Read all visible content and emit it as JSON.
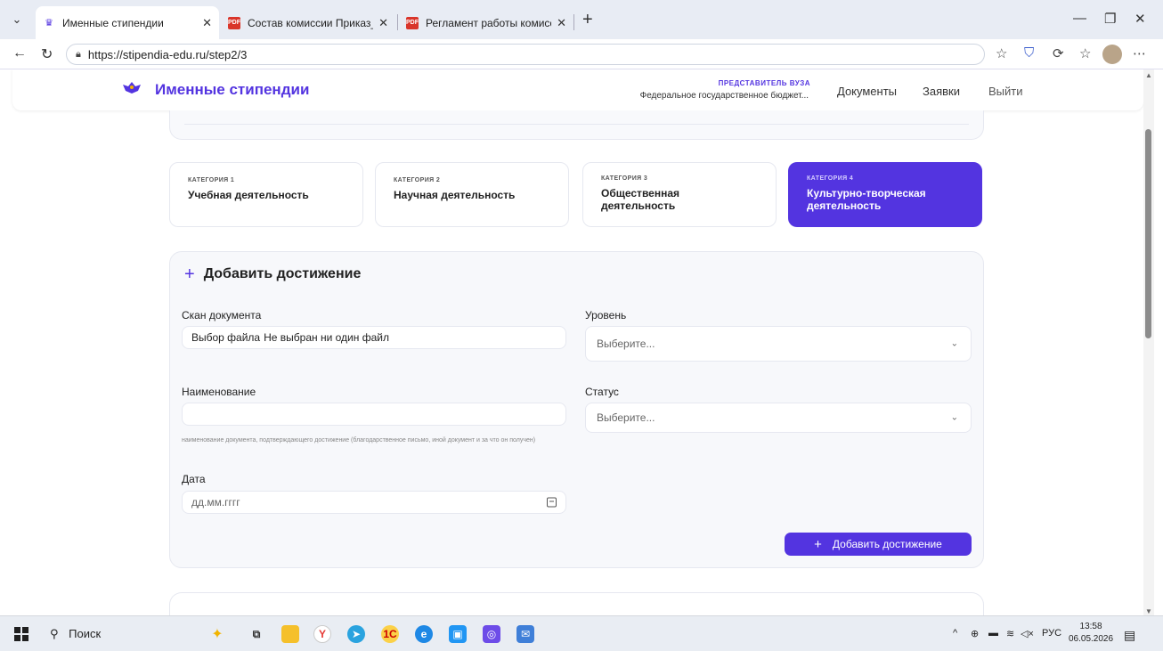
{
  "browser": {
    "tabs": [
      {
        "title": "Именные стипендии",
        "active": true,
        "icon": "scholarship-logo-icon"
      },
      {
        "title": "Состав комиссии Приказ_№296_",
        "active": false,
        "icon": "pdf-icon"
      },
      {
        "title": "Регламент работы комиссии Ми",
        "active": false,
        "icon": "pdf-icon"
      }
    ],
    "url": "https://stipendia-edu.ru/step2/3"
  },
  "site": {
    "name": "Именные стипендии",
    "role_label": "ПРЕДСТАВИТЕЛЬ ВУЗА",
    "organization": "Федеральное государственное бюджет...",
    "nav": [
      {
        "label": "Документы"
      },
      {
        "label": "Заявки"
      },
      {
        "label": "Выйти"
      }
    ]
  },
  "categories": [
    {
      "key": "КАТЕГОРИЯ 1",
      "label": "Учебная деятельность",
      "active": false
    },
    {
      "key": "КАТЕГОРИЯ 2",
      "label": "Научная деятельность",
      "active": false
    },
    {
      "key": "КАТЕГОРИЯ 3",
      "label": "Общественная деятельность",
      "active": false
    },
    {
      "key": "КАТЕГОРИЯ 4",
      "label": "Культурно-творческая деятельность",
      "active": true
    }
  ],
  "form": {
    "title": "Добавить достижение",
    "scan_label": "Скан документа",
    "file_button": "Выбор файла",
    "file_status": "Не выбран ни один файл",
    "level_label": "Уровень",
    "level_placeholder": "Выберите...",
    "name_label": "Наименование",
    "name_value": "",
    "name_hint": "наименование документа, подтверждающего достижение (благодарственное письмо, иной документ и за что он получен)",
    "status_label": "Статус",
    "status_placeholder": "Выберите...",
    "date_label": "Дата",
    "date_placeholder": "дд.мм.гггг",
    "submit_label": "Добавить достижение"
  },
  "taskbar": {
    "search_label": "Поиск",
    "language": "РУС",
    "time": "13:58",
    "date": "06.05.2026"
  },
  "colors": {
    "accent": "#5334e0",
    "card_bg": "#f7f8fb"
  }
}
